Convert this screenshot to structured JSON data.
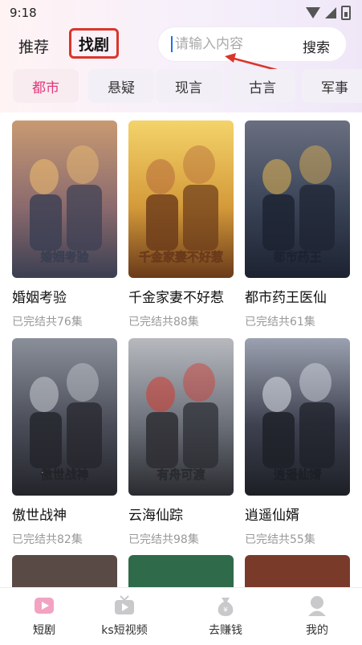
{
  "status_bar": {
    "time": "9:18"
  },
  "nav": {
    "tab_recommend": "推荐",
    "tab_find": "找剧",
    "search_placeholder": "请输入内容",
    "search_button": "搜索"
  },
  "categories": [
    "都市",
    "悬疑",
    "现言",
    "古言",
    "军事"
  ],
  "active_category": "都市",
  "dramas": [
    {
      "title": "婚姻考验",
      "status": "已完结共76集",
      "poster_text": "婚姻考验"
    },
    {
      "title": "千金家妻不好惹",
      "status": "已完结共88集",
      "poster_text": "千金家妻不好惹"
    },
    {
      "title": "都市药王医仙",
      "status": "已完结共61集",
      "poster_text": "都市药王"
    },
    {
      "title": "傲世战神",
      "status": "已完结共82集",
      "poster_text": "傲世战神"
    },
    {
      "title": "云海仙踪",
      "status": "已完结共98集",
      "poster_text": "有舟可渡"
    },
    {
      "title": "逍遥仙婿",
      "status": "已完结共55集",
      "poster_text": "逍遥仙婿"
    }
  ],
  "tabbar": [
    {
      "label": "短剧",
      "icon": "short-drama-icon",
      "active": true
    },
    {
      "label": "ks短视频",
      "icon": "tv-icon",
      "active": false
    },
    {
      "label": "去赚钱",
      "icon": "money-bag-icon",
      "active": false
    },
    {
      "label": "我的",
      "icon": "profile-icon",
      "active": false
    }
  ]
}
